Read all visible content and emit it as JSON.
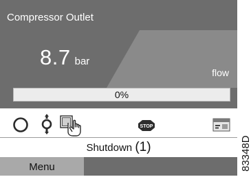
{
  "header": {
    "title": "Compressor Outlet"
  },
  "reading": {
    "value": "8.7",
    "unit": "bar",
    "flow_label": "flow"
  },
  "progress": {
    "text": "0%",
    "value": 0
  },
  "icons": [
    {
      "name": "ring-icon"
    },
    {
      "name": "remote-control-icon"
    },
    {
      "name": "hand-on-display-icon"
    },
    {
      "name": "stop-sign-icon",
      "text": "STOP"
    },
    {
      "name": "service-card-icon"
    }
  ],
  "status": {
    "text": "Shutdown",
    "callout": "(1)"
  },
  "menu": {
    "label": "Menu"
  },
  "figure": {
    "number": "83348D"
  },
  "colors": {
    "panel": "#6d6d6d",
    "panel_light": "#8a8a8a",
    "menu_button": "#a9a9a9",
    "stop": "#c0392b"
  }
}
